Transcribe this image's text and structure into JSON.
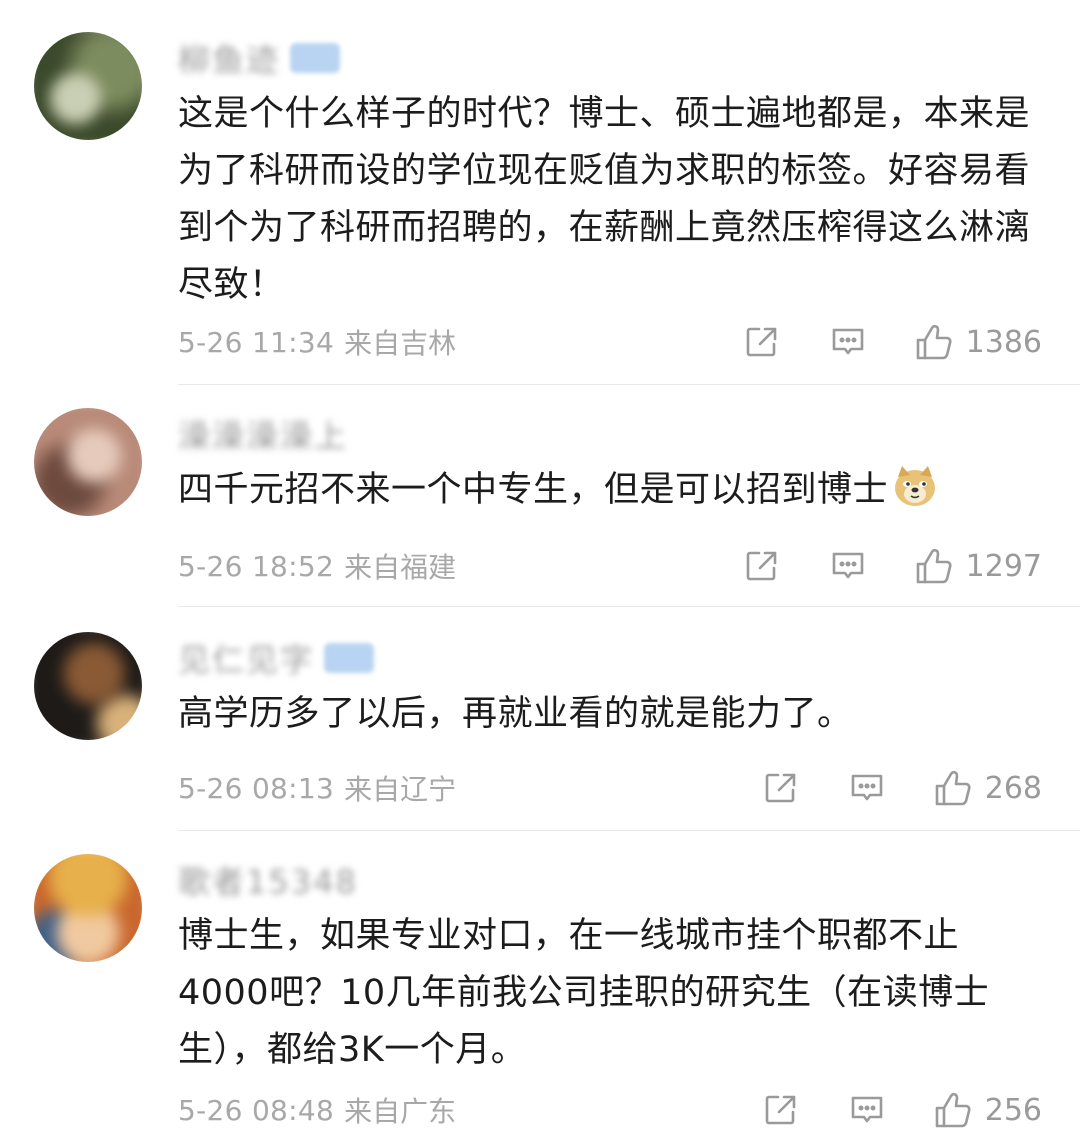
{
  "comments": [
    {
      "username": "柳鱼迹",
      "has_badge": true,
      "text": "这是个什么样子的时代？博士、硕士遍地都是，本来是为了科研而设的学位现在贬值为求职的标签。好容易看到个为了科研而招聘的，在薪酬上竟然压榨得这么淋漓尽致！",
      "time": "5-26 11:34",
      "location": "来自吉林",
      "likes": "1386",
      "avatar_colors": [
        "#3c4a2c",
        "#7d8c5e",
        "#c9cfb4"
      ]
    },
    {
      "username": "澡澡澡澡上",
      "has_badge": false,
      "text": "四千元招不来一个中专生，但是可以招到博士",
      "emoji": "doge-emoji",
      "time": "5-26 18:52",
      "location": "来自福建",
      "likes": "1297",
      "avatar_colors": [
        "#b98a78",
        "#6d4a3e",
        "#e6cbbd"
      ]
    },
    {
      "username": "见仁见字",
      "has_badge": true,
      "text": "高学历多了以后，再就业看的就是能力了。",
      "time": "5-26 08:13",
      "location": "来自辽宁",
      "likes": "268",
      "avatar_colors": [
        "#1d1a17",
        "#8a5a35",
        "#d9b27a"
      ]
    },
    {
      "username": "歌者15348",
      "has_badge": false,
      "text": "博士生，如果专业对口，在一线城市挂个职都不止4000吧？10几年前我公司挂职的研究生（在读博士生），都给3K一个月。",
      "time": "5-26 08:48",
      "location": "来自广东",
      "likes": "256",
      "avatar_colors": [
        "#e7b04a",
        "#c9672d",
        "#3f5f86"
      ]
    }
  ],
  "icons": {
    "share": "share-icon",
    "reply": "comment-icon",
    "like": "thumbs-up-icon"
  }
}
